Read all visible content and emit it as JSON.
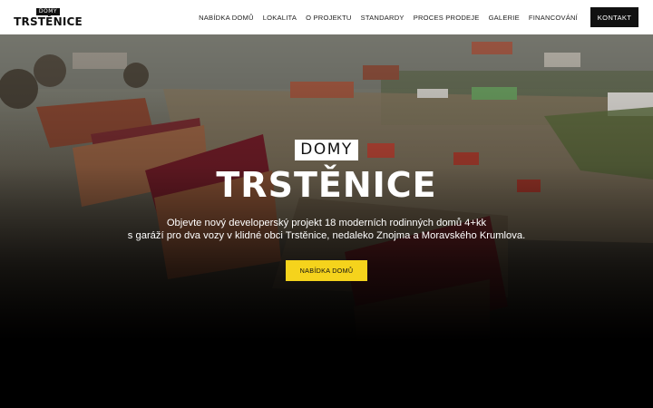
{
  "header": {
    "logo_small": "DOMY",
    "logo_big": "TRSTĚNICE",
    "nav": [
      {
        "label": "NABÍDKA DOMŮ"
      },
      {
        "label": "LOKALITA"
      },
      {
        "label": "O PROJEKTU"
      },
      {
        "label": "STANDARDY"
      },
      {
        "label": "PROCES PRODEJE"
      },
      {
        "label": "GALERIE"
      },
      {
        "label": "FINANCOVÁNÍ"
      }
    ],
    "contact_label": "KONTAKT"
  },
  "hero": {
    "tag": "DOMY",
    "title": "TRSTĚNICE",
    "desc_line1": "Objevte nový developerský projekt 18 moderních rodinných domů 4+kk",
    "desc_line2": "s garáží pro dva vozy v klidné obci Trstěnice, nedaleko Znojma a Moravského Krumlova.",
    "cta_label": "NABÍDKA DOMŮ"
  },
  "colors": {
    "accent": "#f5d31c",
    "header_bg": "#ffffff",
    "dark": "#111111"
  }
}
